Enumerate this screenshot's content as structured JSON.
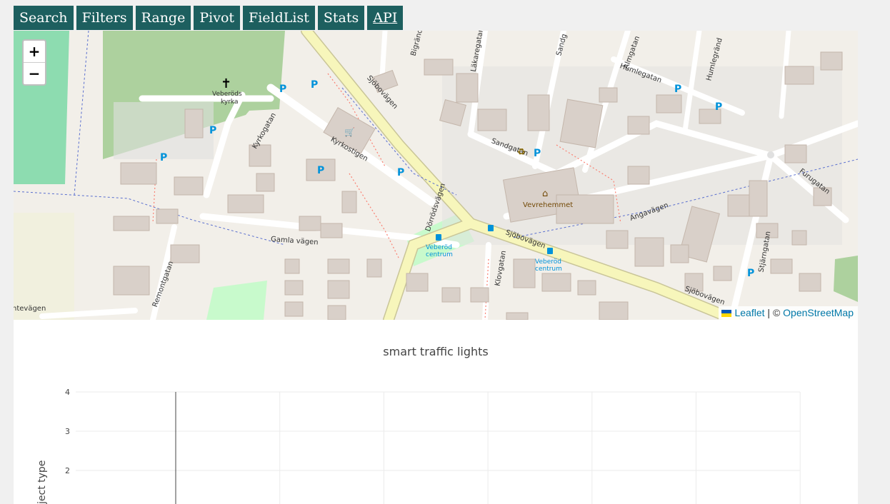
{
  "tabs": [
    {
      "label": "Search"
    },
    {
      "label": "Filters"
    },
    {
      "label": "Range"
    },
    {
      "label": "Pivot"
    },
    {
      "label": "FieldList"
    },
    {
      "label": "Stats"
    },
    {
      "label": "API"
    }
  ],
  "map": {
    "zoom_in": "+",
    "zoom_out": "−",
    "attribution": {
      "leaflet": "Leaflet",
      "separator": " | © ",
      "osm": "OpenStreetMap"
    },
    "labels": {
      "church": "Veberöds\nkyrka",
      "kyrkogatan": "Kyrkogatan",
      "kyrkostigen": "Kyrkostigen",
      "sjobovagen": "Sjöbovägen",
      "dorrodsvagen": "Dörrödsvägen",
      "sandgatan": "Sandgatan",
      "humlegatan": "Humlegatan",
      "angavagen": "Angavägen",
      "gamla_vagen": "Gamla vägen",
      "remontgatan": "Remontgatan",
      "klovgatan": "Klovgatan",
      "furugatan": "Furugatan",
      "stjarngatan": "Stjärngatan",
      "vevrehemmet": "Vevrehemmet",
      "veberod_centrum": "Veberöd centrum",
      "lakaregatan": "Läkaregatan",
      "almgatan": "Almgatan",
      "humlegrand": "Humlegränd",
      "sandg": "Sandg",
      "bigrand": "Bigränd",
      "tevagen": "ntevägen"
    }
  },
  "chart_data": {
    "type": "scatter",
    "title": "smart traffic lights",
    "ylabel": "ject type",
    "y_ticks": [
      "4",
      "3",
      "2"
    ],
    "ylim": [
      1,
      4
    ],
    "grid": true,
    "series": []
  }
}
